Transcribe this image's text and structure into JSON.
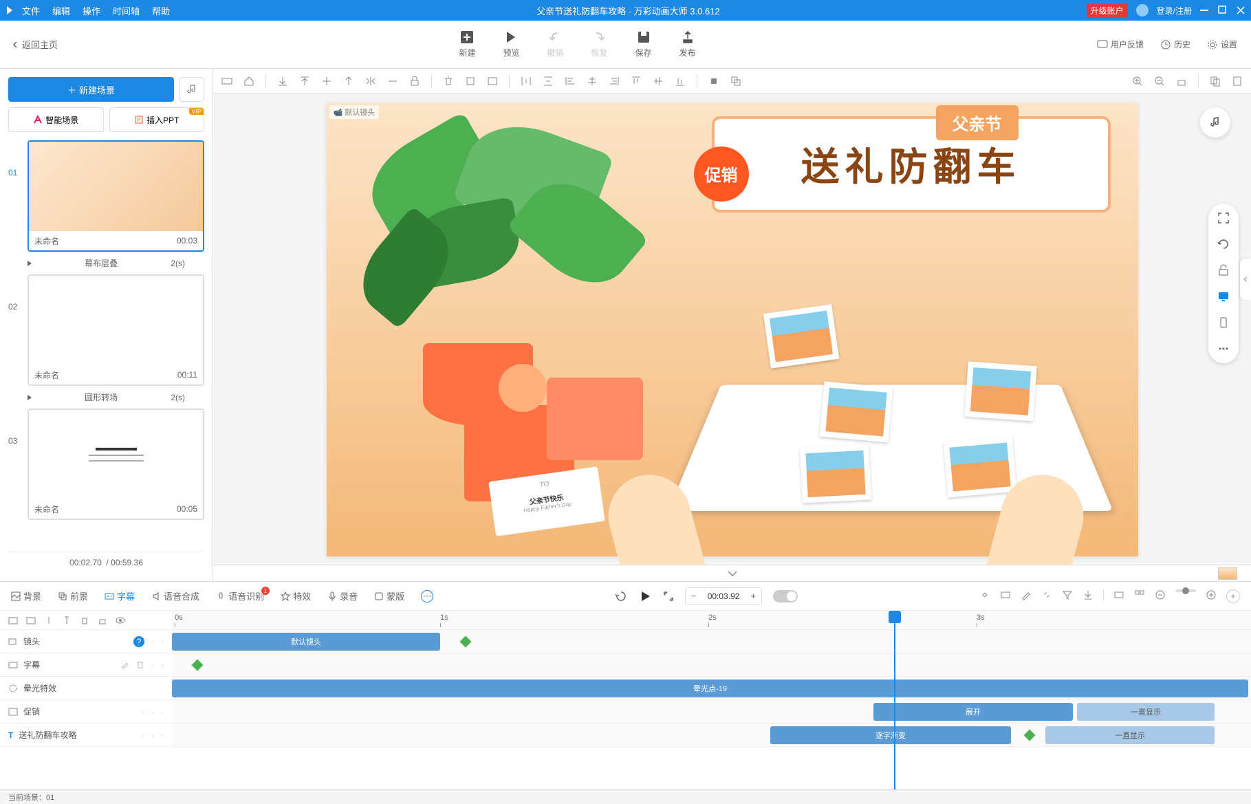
{
  "titlebar": {
    "menus": [
      "文件",
      "编辑",
      "操作",
      "时间轴",
      "帮助"
    ],
    "title": "父亲节送礼防翻车攻略 - 万彩动画大师 3.0.612",
    "upgrade": "升级账户",
    "login": "登录/注册"
  },
  "back_label": "返回主页",
  "main_tools": {
    "new": "新建",
    "preview": "预览",
    "undo": "撤销",
    "redo": "恢复",
    "save": "保存",
    "publish": "发布"
  },
  "right_tools": {
    "feedback": "用户反馈",
    "history": "历史",
    "settings": "设置"
  },
  "sidebar": {
    "new_scene": "新建场景",
    "smart_scene": "智能场景",
    "insert_ppt": "插入PPT",
    "vip": "VIP",
    "scenes": [
      {
        "num": "01",
        "name": "未命名",
        "dur": "00:03",
        "trans": "幕布层叠",
        "trans_dur": "2(s)"
      },
      {
        "num": "02",
        "name": "未命名",
        "dur": "00:11",
        "trans": "圆形转场",
        "trans_dur": "2(s)"
      },
      {
        "num": "03",
        "name": "未命名",
        "dur": "00:05"
      }
    ],
    "time_current": "00:02.70",
    "time_total": "/ 00:59.36"
  },
  "canvas": {
    "camera_label": "默认镜头",
    "banner_text": "送礼防翻车",
    "fq_tag": "父亲节",
    "promo": "促销",
    "card_to": "TO",
    "card_text": "父亲节快乐",
    "card_sub": "Happy Father's Day"
  },
  "bottom_tabs": {
    "bg": "背景",
    "fg": "前景",
    "subtitle": "字幕",
    "tts": "语音合成",
    "asr": "语音识别",
    "fx": "特效",
    "record": "录音",
    "mask": "蒙版",
    "badge": "1"
  },
  "playback": {
    "time": "00:03.92"
  },
  "tracks": {
    "ruler": [
      "0s",
      "1s",
      "2s",
      "3s"
    ],
    "camera": {
      "label": "镜头",
      "clip": "默认镜头"
    },
    "subtitle": {
      "label": "字幕"
    },
    "fx": {
      "label": "晕光特效",
      "clip": "晕光点-19"
    },
    "promo": {
      "label": "促销",
      "clip1": "展开",
      "clip2": "一直显示"
    },
    "title": {
      "label": "送礼防翻车攻略",
      "clip1": "逐字渐变",
      "clip2": "一直显示"
    }
  },
  "status": {
    "current_scene": "当前场景：01"
  }
}
